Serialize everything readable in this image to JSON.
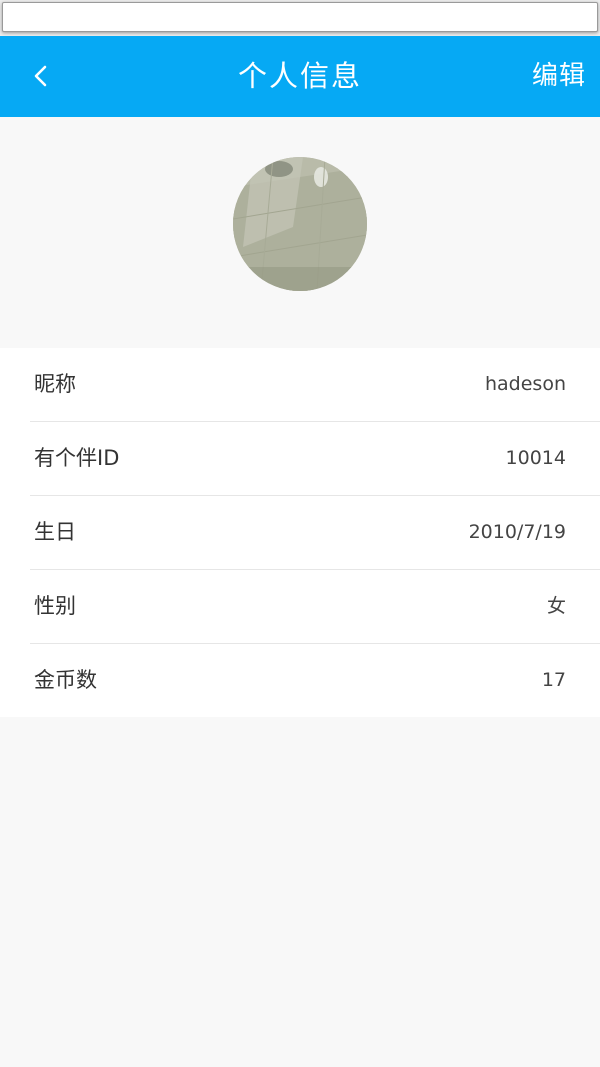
{
  "header": {
    "title": "个人信息",
    "edit_label": "编辑",
    "background_color": "#06a9f4",
    "back_icon": "chevron-left-icon"
  },
  "profile": {
    "rows": [
      {
        "label": "昵称",
        "value": "hadeson"
      },
      {
        "label": "有个伴ID",
        "value": "10014"
      },
      {
        "label": "生日",
        "value": "2010/7/19"
      },
      {
        "label": "性别",
        "value": "女"
      },
      {
        "label": "金币数",
        "value": "17"
      }
    ]
  }
}
